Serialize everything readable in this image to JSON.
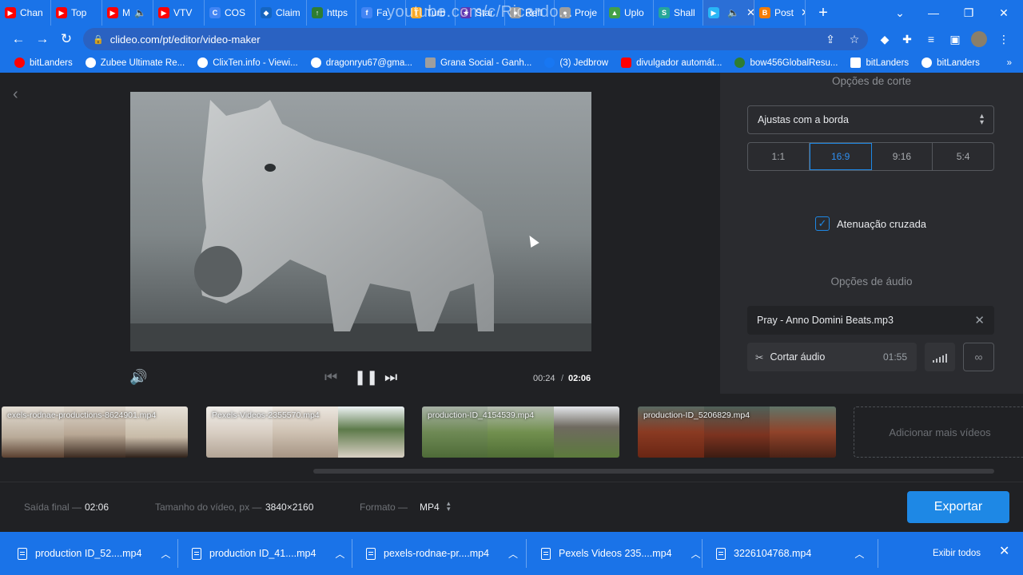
{
  "browser": {
    "tabs": [
      {
        "label": "Chan",
        "icon": "youtube-icon",
        "color": "#ff0000"
      },
      {
        "label": "Top",
        "icon": "youtube-icon",
        "color": "#ff0000"
      },
      {
        "label": "M",
        "icon": "youtube-icon",
        "color": "#ff0000"
      },
      {
        "label": "VTV",
        "icon": "youtube-icon",
        "color": "#ff0000"
      },
      {
        "label": "COS",
        "icon": "cos-icon",
        "color": "#4285f4"
      },
      {
        "label": "Claim",
        "icon": "drop-icon",
        "color": "#1565c0"
      },
      {
        "label": "https",
        "icon": "arrow-up-icon",
        "color": "#2e7d32"
      },
      {
        "label": "Fa",
        "icon": "fa-icon",
        "color": "#4285f4"
      },
      {
        "label": "Turb",
        "icon": "turbo-icon",
        "color": "#f9a825"
      },
      {
        "label": "Star",
        "icon": "star-icon",
        "color": "#5e35b1"
      },
      {
        "label": "Refl",
        "icon": "globe-icon",
        "color": "#9e9e9e"
      },
      {
        "label": "Proje",
        "icon": "globe-icon",
        "color": "#9e9e9e"
      },
      {
        "label": "Uplo",
        "icon": "upload-icon",
        "color": "#43a047"
      },
      {
        "label": "Shall",
        "icon": "s-icon",
        "color": "#26a69a"
      },
      {
        "label": "",
        "icon": "play-icon",
        "color": "#29b6f6"
      },
      {
        "label": "Post",
        "icon": "b-icon",
        "color": "#f57c00"
      }
    ],
    "watermark": "youtube.com/c/Ricardo...",
    "url": "clideo.com/pt/editor/video-maker",
    "bookmarks": [
      {
        "label": "bitLanders",
        "color": "#ffffff"
      },
      {
        "label": "Zubee Ultimate Re...",
        "color": "#ffffff"
      },
      {
        "label": "ClixTen.info - Viewi...",
        "color": "#ffffff"
      },
      {
        "label": "dragonryu67@gma...",
        "color": "#ffffff"
      },
      {
        "label": "Grana Social - Ganh...",
        "color": "#9e9e9e"
      },
      {
        "label": "(3) Jedbrow",
        "color": "#1877f2"
      },
      {
        "label": "divulgador automát...",
        "color": "#ff0000"
      },
      {
        "label": "bow456GlobalResu...",
        "color": "#2e7d32"
      },
      {
        "label": "bitLanders",
        "color": "#ffffff"
      },
      {
        "label": "bitLanders",
        "color": "#ffffff"
      }
    ]
  },
  "player": {
    "time_current": "00:24",
    "time_separator": "/",
    "time_total": "02:06"
  },
  "panel": {
    "crop_title": "Opções de corte",
    "crop_select": "Ajustas com a borda",
    "ratios": [
      "1:1",
      "16:9",
      "9:16",
      "5:4"
    ],
    "active_ratio": "16:9",
    "crossfade_label": "Atenuação cruzada",
    "audio_title": "Opções de áudio",
    "audio_file": "Pray - Anno Domini Beats.mp3",
    "cut_audio_label": "Cortar áudio",
    "audio_duration": "01:55"
  },
  "timeline": {
    "clips": [
      {
        "name": "exels-rodnae-productions-8624901.mp4"
      },
      {
        "name": "Pexels-Videos-2355570.mp4"
      },
      {
        "name": "production-ID_4154539.mp4"
      },
      {
        "name": "production-ID_5206829.mp4"
      }
    ],
    "add_more": "Adicionar mais vídeos"
  },
  "footer": {
    "output_label": "Saída final —",
    "output_value": "02:06",
    "size_label": "Tamanho do vídeo, px —",
    "size_value": "3840×2160",
    "format_label": "Formato —",
    "format_value": "MP4",
    "export_label": "Exportar"
  },
  "downloads": {
    "items": [
      "production ID_52....mp4",
      "production ID_41....mp4",
      "pexels-rodnae-pr....mp4",
      "Pexels Videos 235....mp4",
      "3226104768.mp4"
    ],
    "show_all": "Exibir todos"
  },
  "colors": {
    "accent": "#1e88e5",
    "browser_chrome": "#1a73e8",
    "editor_bg": "#202124",
    "panel_bg": "#2a2b2f"
  }
}
